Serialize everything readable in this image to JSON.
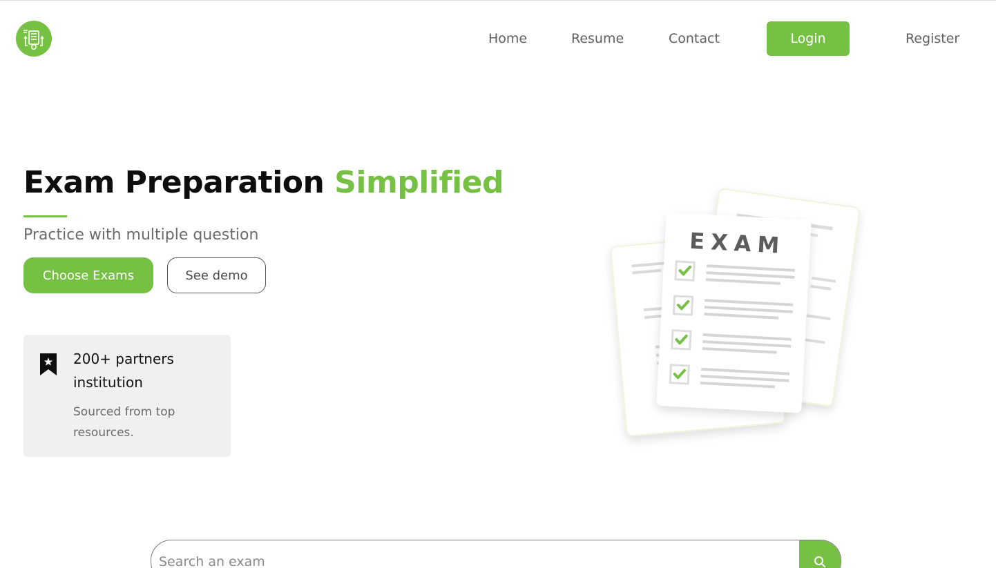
{
  "brand": {
    "accent_color": "#76c043",
    "logo_icon": "exam-document-icon"
  },
  "nav": {
    "items": [
      {
        "label": "Home"
      },
      {
        "label": "Resume"
      },
      {
        "label": "Contact"
      }
    ],
    "login_label": "Login",
    "register_label": "Register"
  },
  "hero": {
    "title_main": "Exam Preparation",
    "title_accent": "Simplified",
    "subtitle": "Practice with multiple question",
    "primary_button": "Choose Exams",
    "secondary_button": "See demo"
  },
  "info_card": {
    "icon": "bookmark-star-icon",
    "title": "200+ partners institution",
    "description": "Sourced from top resources."
  },
  "illustration": {
    "heading": "EXAM",
    "checked_items": 4
  },
  "search": {
    "placeholder": "Search an exam",
    "value": "",
    "button_icon": "search-icon"
  }
}
